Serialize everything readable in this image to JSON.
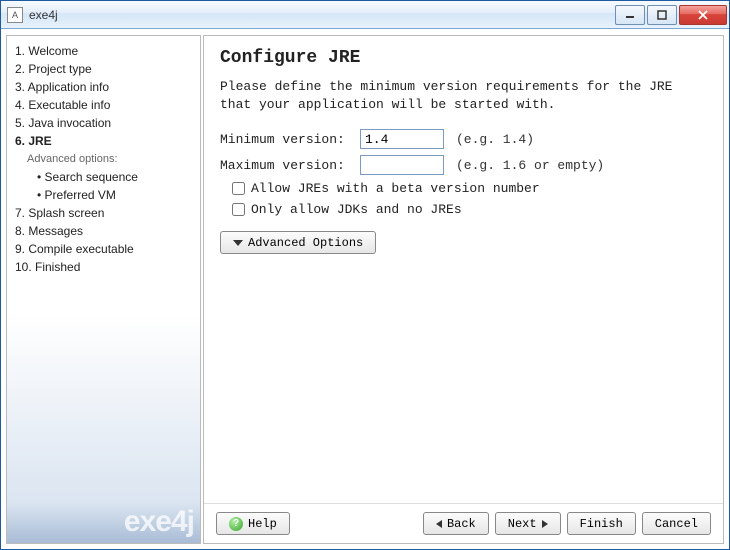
{
  "window": {
    "title": "exe4j",
    "icon_letter": "A"
  },
  "sidebar": {
    "steps": [
      {
        "num": "1.",
        "label": "Welcome",
        "active": false
      },
      {
        "num": "2.",
        "label": "Project type",
        "active": false
      },
      {
        "num": "3.",
        "label": "Application info",
        "active": false
      },
      {
        "num": "4.",
        "label": "Executable info",
        "active": false
      },
      {
        "num": "5.",
        "label": "Java invocation",
        "active": false
      },
      {
        "num": "6.",
        "label": "JRE",
        "active": true
      }
    ],
    "advanced_label": "Advanced options:",
    "advanced_items": [
      {
        "bullet": "•",
        "label": "Search sequence"
      },
      {
        "bullet": "•",
        "label": "Preferred VM"
      }
    ],
    "steps_after": [
      {
        "num": "7.",
        "label": "Splash screen",
        "active": false
      },
      {
        "num": "8.",
        "label": "Messages",
        "active": false
      },
      {
        "num": "9.",
        "label": "Compile executable",
        "active": false
      },
      {
        "num": "10.",
        "label": "Finished",
        "active": false
      }
    ],
    "brand": "exe4j"
  },
  "main": {
    "title": "Configure JRE",
    "description": "Please define the minimum version requirements for the JRE that your application will be started with.",
    "min_label": "Minimum version:",
    "min_value": "1.4",
    "min_hint": "(e.g. 1.4)",
    "max_label": "Maximum version:",
    "max_value": "",
    "max_hint": "(e.g. 1.6 or empty)",
    "check1": "Allow JREs with a beta version number",
    "check2": "Only allow JDKs and no JREs",
    "adv_button": "Advanced Options"
  },
  "footer": {
    "help": "Help",
    "back": "Back",
    "next": "Next",
    "finish": "Finish",
    "cancel": "Cancel"
  }
}
